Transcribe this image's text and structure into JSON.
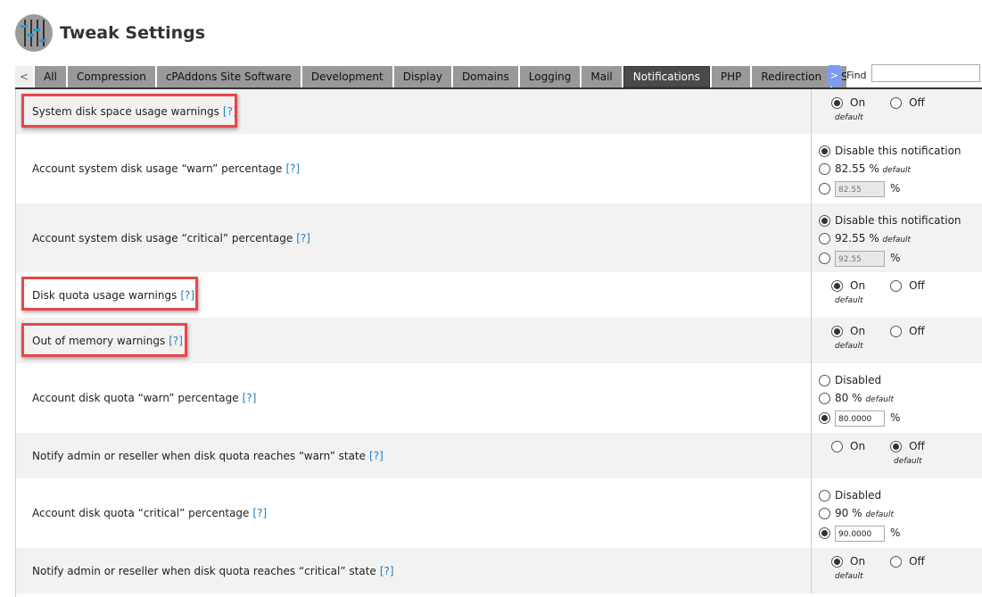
{
  "header": {
    "title": "Tweak Settings"
  },
  "tabs": [
    "All",
    "Compression",
    "cPAddons Site Software",
    "Development",
    "Display",
    "Domains",
    "Logging",
    "Mail",
    "Notifications",
    "PHP",
    "Redirection",
    "Securi"
  ],
  "active_tab": "Notifications",
  "nav": {
    "prev": "<",
    "next": ">"
  },
  "find": {
    "label": "Find",
    "value": ""
  },
  "help": "[?]",
  "labels": {
    "on": "On",
    "off": "Off",
    "default": "default",
    "disable": "Disable this notification",
    "disabled": "Disabled",
    "pct": "%"
  },
  "rows": [
    {
      "label": "System disk space usage warnings",
      "selected": "On"
    },
    {
      "label": "Account system disk usage “warn” percentage",
      "default_value": "82.55",
      "input": "82.55",
      "selected": "disable"
    },
    {
      "label": "Account system disk usage “critical” percentage",
      "default_value": "92.55",
      "input": "92.55",
      "selected": "disable"
    },
    {
      "label": "Disk quota usage warnings",
      "selected": "On"
    },
    {
      "label": "Out of memory warnings",
      "selected": "On"
    },
    {
      "label": "Account disk quota “warn” percentage",
      "default_value": "80",
      "input": "80.0000",
      "selected": "custom"
    },
    {
      "label": "Notify admin or reseller when disk quota reaches “warn” state",
      "selected": "Off"
    },
    {
      "label": "Account disk quota “critical” percentage",
      "default_value": "90",
      "input": "90.0000",
      "selected": "custom"
    },
    {
      "label": "Notify admin or reseller when disk quota reaches “critical” state",
      "selected": "On"
    }
  ]
}
